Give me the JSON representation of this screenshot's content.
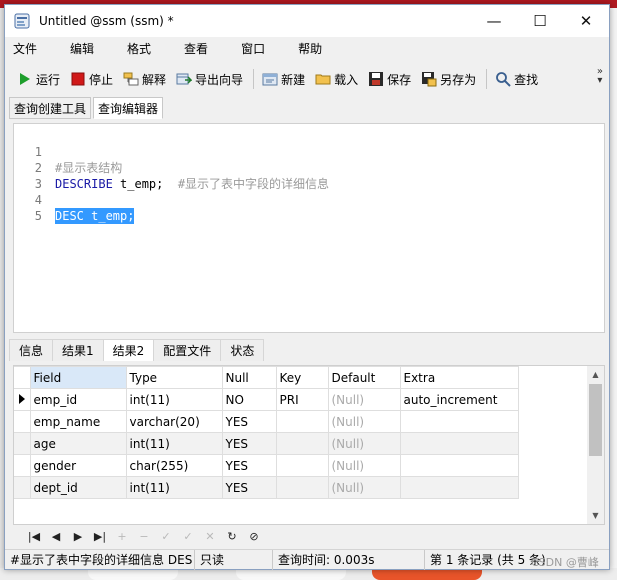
{
  "window": {
    "title": "Untitled @ssm (ssm) *",
    "minimize": "—",
    "maximize": "☐",
    "close": "✕"
  },
  "menu": [
    "文件",
    "编辑",
    "格式",
    "查看",
    "窗口",
    "帮助"
  ],
  "toolbar": {
    "run": "运行",
    "stop": "停止",
    "explain": "解释",
    "export_wizard": "导出向导",
    "new": "新建",
    "load": "载入",
    "save": "保存",
    "save_as": "另存为",
    "find": "查找",
    "more": "»"
  },
  "query_tabs": [
    "查询创建工具",
    "查询编辑器"
  ],
  "editor": {
    "lines": [
      {
        "num": "1",
        "text": "#显示表结构"
      },
      {
        "num": "2",
        "keyword": "DESCRIBE",
        "rest": " t_emp;",
        "comment": "  #显示了表中字段的详细信息"
      },
      {
        "num": "3",
        "text": ""
      },
      {
        "num": "4",
        "selected": "DESC t_emp;"
      },
      {
        "num": "5",
        "text": ""
      }
    ]
  },
  "result_tabs": [
    "信息",
    "结果1",
    "结果2",
    "配置文件",
    "状态"
  ],
  "grid": {
    "columns": [
      "Field",
      "Type",
      "Null",
      "Key",
      "Default",
      "Extra"
    ],
    "rows": [
      [
        "emp_id",
        "int(11)",
        "NO",
        "PRI",
        "(Null)",
        "auto_increment"
      ],
      [
        "emp_name",
        "varchar(20)",
        "YES",
        "",
        "(Null)",
        ""
      ],
      [
        "age",
        "int(11)",
        "YES",
        "",
        "(Null)",
        ""
      ],
      [
        "gender",
        "char(255)",
        "YES",
        "",
        "(Null)",
        ""
      ],
      [
        "dept_id",
        "int(11)",
        "YES",
        "",
        "(Null)",
        ""
      ]
    ]
  },
  "navigation": {
    "first": "|◀",
    "prev": "◀",
    "next": "▶",
    "last": "▶|",
    "add": "+",
    "delete": "−",
    "edit": "✓",
    "apply": "✓",
    "cancel": "✕",
    "refresh": "↻",
    "stop": "⊘"
  },
  "status": {
    "sql": "#显示了表中字段的详细信息  DES",
    "mode": "只读",
    "query_time": "查询时间: 0.003s",
    "record_info": "第 1 条记录 (共 5 条)"
  },
  "watermark": "CSDN @曹峰",
  "colors": {
    "selection": "#3399ff",
    "keyword": "#1a1aa6",
    "comment": "#9a9a9a",
    "stop_icon": "#d01818",
    "run_icon": "#1e9e2c"
  }
}
